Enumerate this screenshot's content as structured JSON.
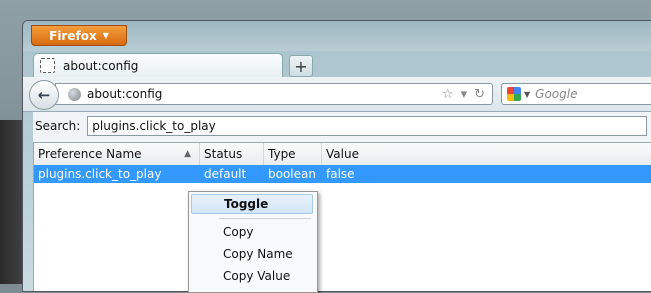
{
  "browser": {
    "firefox_button": "Firefox",
    "tab_title": "about:config",
    "new_tab": "+",
    "url": "about:config",
    "search_placeholder": "Google"
  },
  "config": {
    "search_label": "Search:",
    "search_value": "plugins.click_to_play",
    "columns": [
      "Preference Name",
      "Status",
      "Type",
      "Value"
    ],
    "row": {
      "name": "plugins.click_to_play",
      "status": "default",
      "type": "boolean",
      "value": "false"
    }
  },
  "context_menu": {
    "toggle": "Toggle",
    "copy": "Copy",
    "copy_name": "Copy Name",
    "copy_value": "Copy Value"
  }
}
